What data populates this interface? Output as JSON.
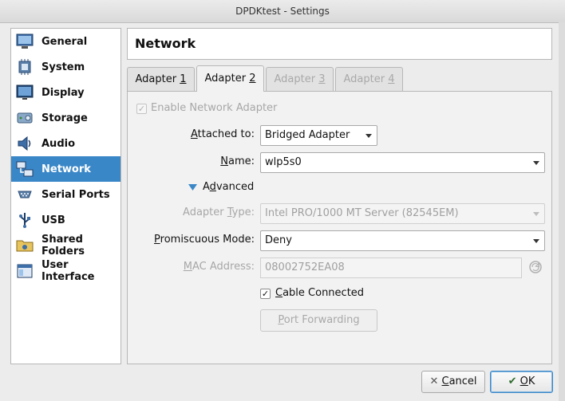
{
  "window": {
    "title": "DPDKtest - Settings"
  },
  "sidebar": {
    "items": [
      {
        "label": "General",
        "icon": "general-icon",
        "selected": false
      },
      {
        "label": "System",
        "icon": "system-icon",
        "selected": false
      },
      {
        "label": "Display",
        "icon": "display-icon",
        "selected": false
      },
      {
        "label": "Storage",
        "icon": "storage-icon",
        "selected": false
      },
      {
        "label": "Audio",
        "icon": "audio-icon",
        "selected": false
      },
      {
        "label": "Network",
        "icon": "network-icon",
        "selected": true
      },
      {
        "label": "Serial Ports",
        "icon": "serial-ports-icon",
        "selected": false
      },
      {
        "label": "USB",
        "icon": "usb-icon",
        "selected": false
      },
      {
        "label": "Shared Folders",
        "icon": "shared-folders-icon",
        "selected": false
      },
      {
        "label": "User Interface",
        "icon": "user-interface-icon",
        "selected": false
      }
    ]
  },
  "page": {
    "title": "Network"
  },
  "tabs": [
    {
      "label": "Adapter ",
      "mnemonic": "1",
      "active": false,
      "enabled": true
    },
    {
      "label": "Adapter ",
      "mnemonic": "2",
      "active": true,
      "enabled": true
    },
    {
      "label": "Adapter ",
      "mnemonic": "3",
      "active": false,
      "enabled": false
    },
    {
      "label": "Adapter ",
      "mnemonic": "4",
      "active": false,
      "enabled": false
    }
  ],
  "form": {
    "enable_adapter": {
      "label": "Enable Network Adapter",
      "checked": true,
      "enabled": false
    },
    "attached_to": {
      "label": "Attached to:",
      "mnemonic": "A",
      "rest": "ttached to:",
      "value": "Bridged Adapter"
    },
    "name": {
      "label": "Name:",
      "mnemonic": "N",
      "rest": "ame:",
      "value": "wlp5s0"
    },
    "advanced": {
      "mnemonic": "d",
      "pre": "A",
      "rest": "vanced",
      "expanded": true
    },
    "adapter_type": {
      "label": "Adapter Type:",
      "pre": "Adapter ",
      "mnemonic": "T",
      "rest": "ype:",
      "value": "Intel PRO/1000 MT Server (82545EM)",
      "enabled": false
    },
    "promiscuous_mode": {
      "pre": "",
      "mnemonic": "P",
      "rest": "romiscuous Mode:",
      "value": "Deny"
    },
    "mac_address": {
      "pre": "",
      "mnemonic": "M",
      "rest": "AC Address:",
      "value": "08002752EA08",
      "enabled": false
    },
    "cable_connected": {
      "pre": "",
      "mnemonic": "C",
      "rest": "able Connected",
      "checked": true
    },
    "port_forwarding": {
      "pre": "",
      "mnemonic": "P",
      "rest": "ort Forwarding",
      "enabled": false
    }
  },
  "buttons": {
    "cancel": {
      "mnemonic": "C",
      "rest": "ancel",
      "icon": "cancel-x-icon"
    },
    "ok": {
      "mnemonic": "O",
      "rest": "K",
      "icon": "ok-check-icon"
    }
  },
  "colors": {
    "selection": "#3a87c8",
    "disabled_text": "#a9a9a9"
  }
}
